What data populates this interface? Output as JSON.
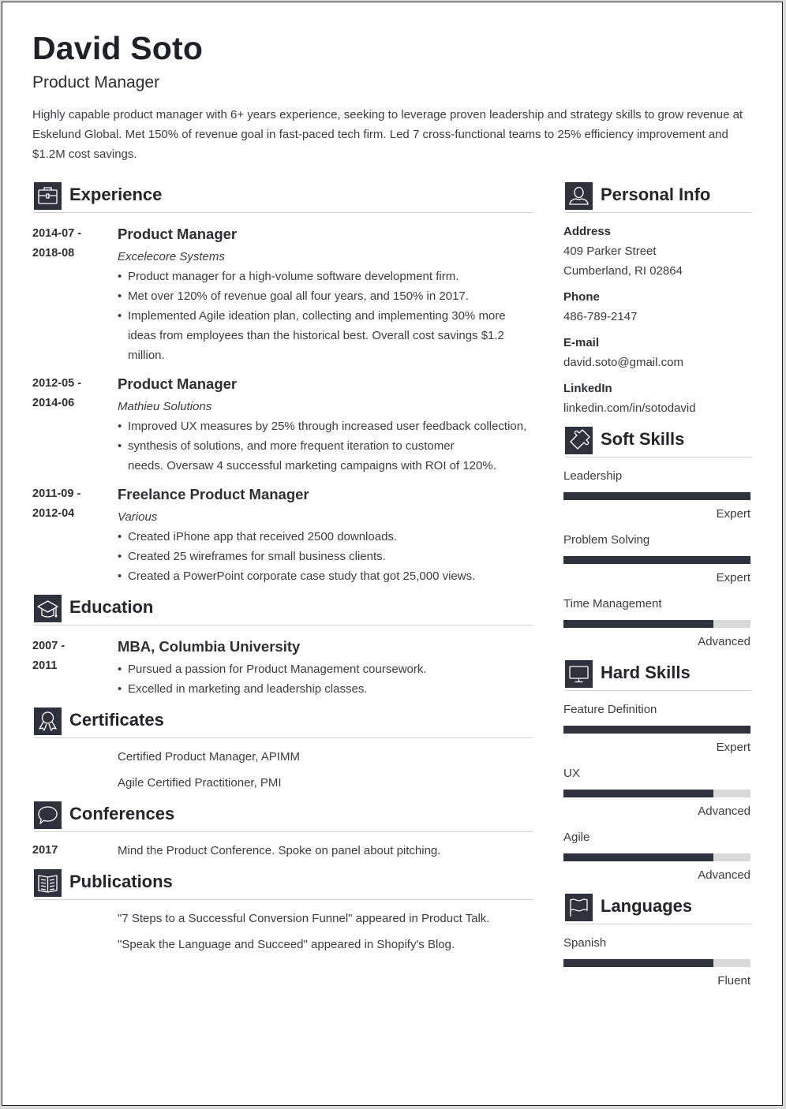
{
  "header": {
    "name": "David Soto",
    "role": "Product Manager",
    "summary": "Highly capable product manager with 6+ years experience, seeking to leverage proven leadership and strategy skills to grow revenue at Eskelund Global. Met 150% of revenue goal in fast-paced tech firm. Led 7 cross-functional teams to 25% efficiency improvement and $1.2M cost savings."
  },
  "experience": {
    "title": "Experience",
    "icon": "briefcase-icon",
    "items": [
      {
        "date_start": "2014-07 -",
        "date_end": "2018-08",
        "title": "Product Manager",
        "company": "Excelecore Systems",
        "bullets": [
          "Product manager for a high-volume software development firm.",
          "Met over 120% of revenue goal all four years, and 150% in 2017.",
          "Implemented Agile ideation plan, collecting and implementing 30% more ideas from employees than the historical best. Overall cost savings $1.2 million."
        ]
      },
      {
        "date_start": "2012-05 -",
        "date_end": "2014-06",
        "title": "Product Manager",
        "company": "Mathieu Solutions",
        "bullets": [
          "Improved UX measures by 25% through increased user feedback collection,",
          "synthesis of solutions, and more frequent iteration to customer",
          "needs. Oversaw 4 successful marketing campaigns with ROI of 120%."
        ]
      },
      {
        "date_start": "2011-09 -",
        "date_end": "2012-04",
        "title": "Freelance Product Manager",
        "company": "Various",
        "bullets": [
          "Created iPhone app that received 2500 downloads.",
          "Created 25 wireframes for small business clients.",
          "Created a PowerPoint corporate case study that got 25,000 views."
        ]
      }
    ]
  },
  "education": {
    "title": "Education",
    "icon": "graduation-cap-icon",
    "items": [
      {
        "date_start": "2007 -",
        "date_end": "2011",
        "title": "MBA, Columbia University",
        "bullets": [
          "Pursued a passion for Product Management coursework.",
          "Excelled in marketing and leadership classes."
        ]
      }
    ]
  },
  "certificates": {
    "title": "Certificates",
    "icon": "award-ribbon-icon",
    "items": [
      "Certified Product Manager, APIMM",
      "Agile Certified Practitioner, PMI"
    ]
  },
  "conferences": {
    "title": "Conferences",
    "icon": "speech-bubble-icon",
    "items": [
      {
        "year": "2017",
        "text": "Mind the Product Conference. Spoke on panel about pitching."
      }
    ]
  },
  "publications": {
    "title": "Publications",
    "icon": "open-book-icon",
    "items": [
      "\"7 Steps to a Successful Conversion Funnel\" appeared in Product Talk.",
      "\"Speak the Language and Succeed\" appeared in Shopify's Blog."
    ]
  },
  "personal_info": {
    "title": "Personal Info",
    "icon": "user-icon",
    "address_label": "Address",
    "address_line1": "409 Parker Street",
    "address_line2": "Cumberland, RI 02864",
    "phone_label": "Phone",
    "phone": "486-789-2147",
    "email_label": "E-mail",
    "email": "david.soto@gmail.com",
    "linkedin_label": "LinkedIn",
    "linkedin": "linkedin.com/in/sotodavid"
  },
  "soft_skills": {
    "title": "Soft Skills",
    "icon": "puzzle-piece-icon",
    "items": [
      {
        "name": "Leadership",
        "level": "Expert",
        "fraction": 1.0
      },
      {
        "name": "Problem Solving",
        "level": "Expert",
        "fraction": 1.0
      },
      {
        "name": "Time Management",
        "level": "Advanced",
        "fraction": 0.8
      }
    ]
  },
  "hard_skills": {
    "title": "Hard Skills",
    "icon": "monitor-icon",
    "items": [
      {
        "name": "Feature Definition",
        "level": "Expert",
        "fraction": 1.0
      },
      {
        "name": "UX",
        "level": "Advanced",
        "fraction": 0.8
      },
      {
        "name": "Agile",
        "level": "Advanced",
        "fraction": 0.8
      }
    ]
  },
  "languages": {
    "title": "Languages",
    "icon": "flag-icon",
    "items": [
      {
        "name": "Spanish",
        "level": "Fluent",
        "fraction": 0.8
      }
    ]
  },
  "colors": {
    "accent": "#2d323d",
    "bar_track": "#d9d9d9",
    "rule": "#d4d4d4",
    "text": "#2d2f33"
  }
}
